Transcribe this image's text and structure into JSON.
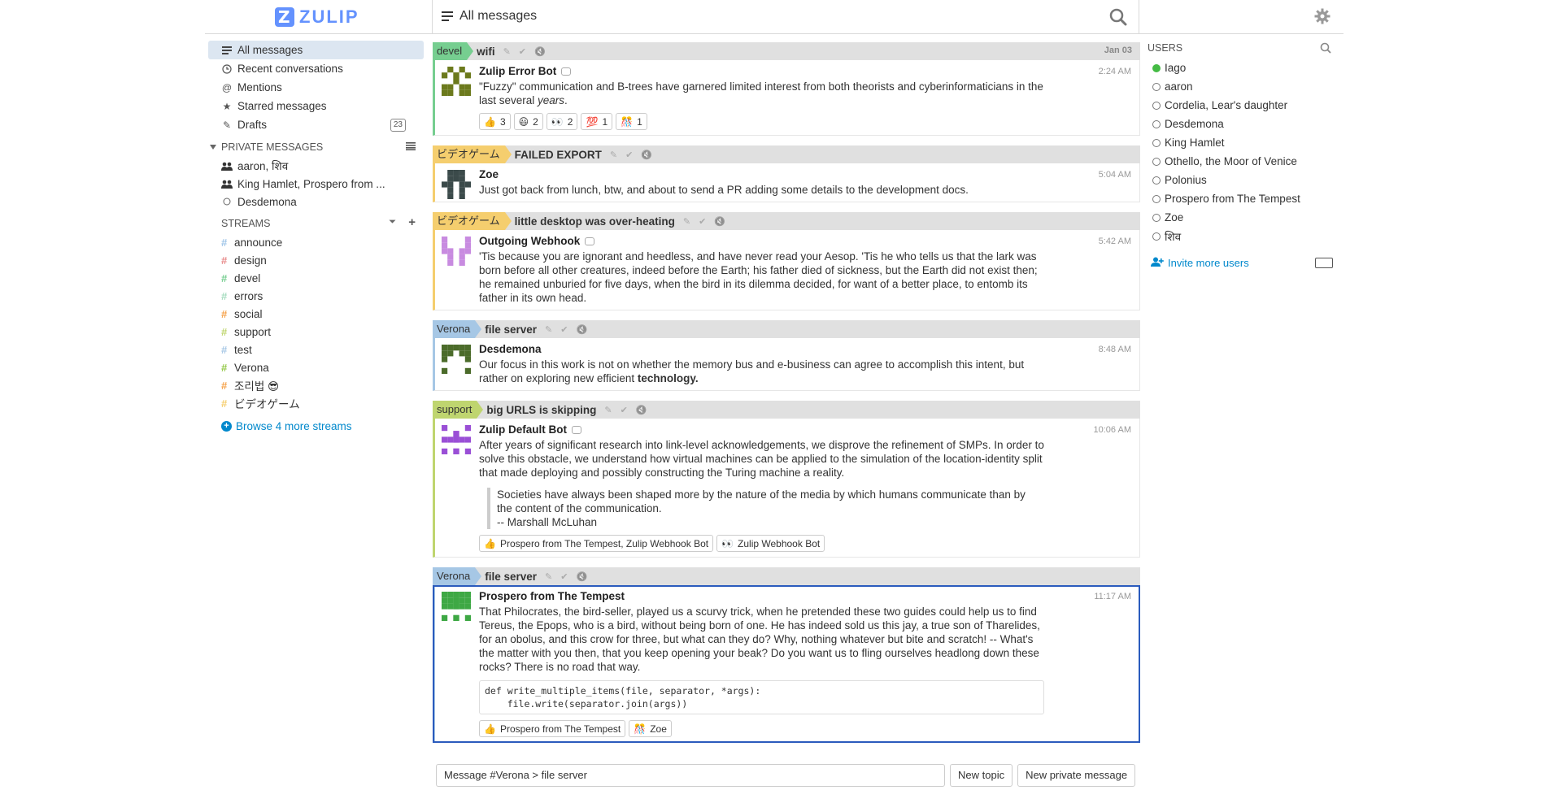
{
  "app": {
    "logo_text": "ZULIP"
  },
  "header": {
    "title": "All messages"
  },
  "left_nav": [
    {
      "label": "All messages",
      "icon": "all-messages-icon"
    },
    {
      "label": "Recent conversations",
      "icon": "clock-icon"
    },
    {
      "label": "Mentions",
      "icon": "at-icon"
    },
    {
      "label": "Starred messages",
      "icon": "star-icon"
    },
    {
      "label": "Drafts",
      "icon": "pencil-icon",
      "count": "23"
    }
  ],
  "private_messages": {
    "heading": "PRIVATE MESSAGES",
    "items": [
      {
        "label": "aaron, शिव"
      },
      {
        "label": "King Hamlet, Prospero from ..."
      },
      {
        "label": "Desdemona"
      }
    ]
  },
  "streams": {
    "heading": "STREAMS",
    "items": [
      {
        "name": "announce",
        "color": "#9fc5e8"
      },
      {
        "name": "design",
        "color": "#e88a8a"
      },
      {
        "name": "devel",
        "color": "#76ce90"
      },
      {
        "name": "errors",
        "color": "#a6dcbf"
      },
      {
        "name": "social",
        "color": "#f5a24a"
      },
      {
        "name": "support",
        "color": "#bfd56f"
      },
      {
        "name": "test",
        "color": "#a6c7e5"
      },
      {
        "name": "Verona",
        "color": "#94c849"
      },
      {
        "name": "조리법 😎",
        "color": "#f5a24a"
      },
      {
        "name": "ビデオゲーム",
        "color": "#f5ce6e"
      }
    ],
    "browse_label": "Browse 4 more streams"
  },
  "message_groups": [
    {
      "stream": "devel",
      "stream_color": "#76ce90",
      "topic": "wifi",
      "date": "Jan 03",
      "messages": [
        {
          "sender": "Zulip Error Bot",
          "bot": true,
          "time": "2:24 AM",
          "avatar_color": "#6c7a1d",
          "content_html": "\"Fuzzy\" communication and B-trees have garnered limited interest from both theorists and cyberinformaticians in the last several <i>years</i>.",
          "reactions": [
            {
              "emoji": "👍",
              "count": "3"
            },
            {
              "emoji": "😃",
              "count": "2"
            },
            {
              "emoji": "👀",
              "count": "2"
            },
            {
              "emoji": "💯",
              "count": "1"
            },
            {
              "emoji": "🎊",
              "count": "1"
            }
          ]
        }
      ]
    },
    {
      "stream": "ビデオゲーム",
      "stream_color": "#f5ce6e",
      "topic": "FAILED EXPORT",
      "date": "",
      "messages": [
        {
          "sender": "Zoe",
          "bot": false,
          "time": "5:04 AM",
          "avatar_color": "#3b4a4a",
          "content_html": "Just got back from lunch, btw, and about to send a PR adding some details to the development docs.",
          "reactions": []
        }
      ]
    },
    {
      "stream": "ビデオゲーム",
      "stream_color": "#f5ce6e",
      "topic": "little desktop was over-heating",
      "date": "",
      "messages": [
        {
          "sender": "Outgoing Webhook",
          "bot": true,
          "time": "5:42 AM",
          "avatar_color": "#c88be0",
          "content_html": "'Tis because you are ignorant and heedless, and have never read your Aesop. 'Tis he who tells us that the lark was born before all other creatures, indeed before the Earth; his father died of sickness, but the Earth did not exist then; he remained unburied for five days, when the bird in its dilemma decided, for want of a better place, to entomb its father in its own head.",
          "reactions": []
        }
      ]
    },
    {
      "stream": "Verona",
      "stream_color": "#a6c7e5",
      "topic": "file server",
      "date": "",
      "messages": [
        {
          "sender": "Desdemona",
          "bot": false,
          "time": "8:48 AM",
          "avatar_color": "#4b6b2a",
          "content_html": "Our focus in this work is not on whether the memory bus and e-business can agree to accomplish this intent, but rather on exploring new efficient <b>technology.</b>",
          "reactions": []
        }
      ]
    },
    {
      "stream": "support",
      "stream_color": "#bfd56f",
      "topic": "big URLS is skipping",
      "date": "",
      "messages": [
        {
          "sender": "Zulip Default Bot",
          "bot": true,
          "time": "10:06 AM",
          "avatar_color": "#9a4fd6",
          "content_html": "After years of significant research into link-level acknowledgements, we disprove the refinement of SMPs. In order to solve this obstacle, we understand how virtual machines can be applied to the simulation of the location-identity split that made deploying and possibly constructing the Turing machine a reality.",
          "quote_html": "Societies have always been shaped more by the nature of the media by which humans communicate than by the content of the communication.<br>-- Marshall McLuhan",
          "reactions": [
            {
              "emoji": "👍",
              "count": "Prospero from The Tempest, Zulip Webhook Bot"
            },
            {
              "emoji": "👀",
              "count": "Zulip Webhook Bot"
            }
          ]
        }
      ]
    },
    {
      "stream": "Verona",
      "stream_color": "#a6c7e5",
      "topic": "file server",
      "date": "",
      "selected": true,
      "messages": [
        {
          "sender": "Prospero from The Tempest",
          "bot": false,
          "time": "11:17 AM",
          "avatar_color": "#3ea844",
          "content_html": "That Philocrates, the bird-seller, played us a scurvy trick, when he pretended these two guides could help us to find Tereus, the Epops, who is a bird, without being born of one. He has indeed sold us this jay, a true son of Tharelides, for an obolus, and this crow for three, but what can they do? Why, nothing whatever but bite and scratch! -- What's the matter with you then, that you keep opening your beak? Do you want us to fling ourselves headlong down these rocks? There is no road that way.",
          "code": "def write_multiple_items(file, separator, *args):\n    file.write(separator.join(args))",
          "reactions": [
            {
              "emoji": "👍",
              "count": "Prospero from The Tempest"
            },
            {
              "emoji": "🎊",
              "count": "Zoe"
            }
          ]
        }
      ]
    }
  ],
  "compose": {
    "placeholder": "Message #Verona > file server",
    "new_topic": "New topic",
    "new_pm": "New private message"
  },
  "users": {
    "heading": "USERS",
    "items": [
      {
        "name": "Iago",
        "active": true
      },
      {
        "name": "aaron",
        "active": false
      },
      {
        "name": "Cordelia, Lear's daughter",
        "active": false
      },
      {
        "name": "Desdemona",
        "active": false
      },
      {
        "name": "King Hamlet",
        "active": false
      },
      {
        "name": "Othello, the Moor of Venice",
        "active": false
      },
      {
        "name": "Polonius",
        "active": false
      },
      {
        "name": "Prospero from The Tempest",
        "active": false
      },
      {
        "name": "Zoe",
        "active": false
      },
      {
        "name": "शिव",
        "active": false
      }
    ],
    "invite_label": "Invite more users"
  }
}
